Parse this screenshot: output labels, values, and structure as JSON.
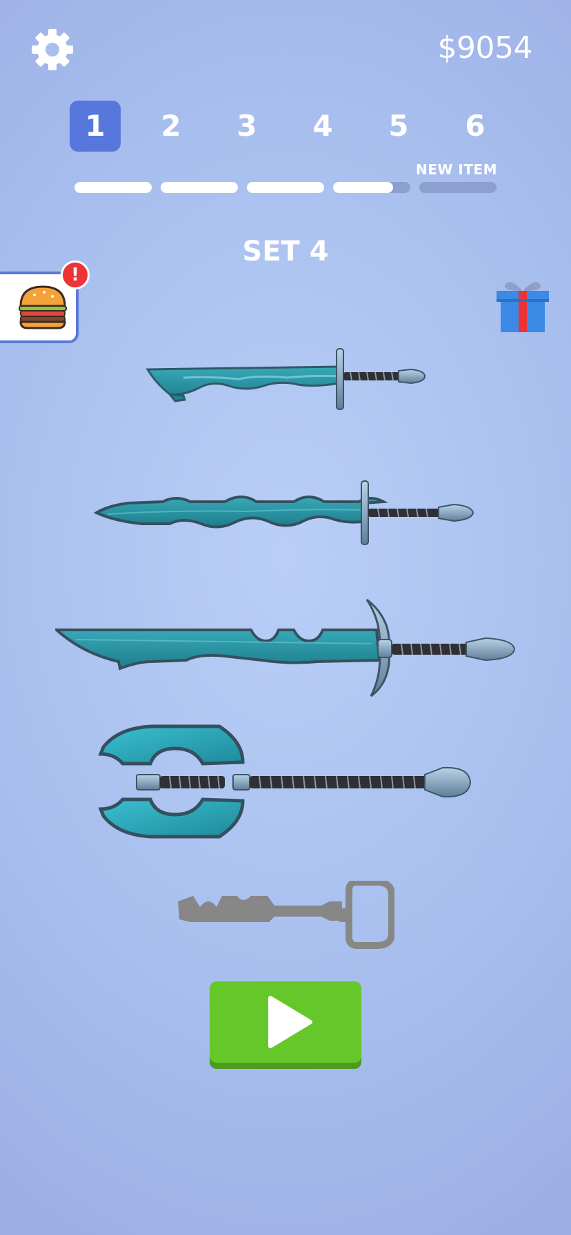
{
  "header": {
    "money": "$9054",
    "settings_icon": "gear-icon"
  },
  "levels": {
    "items": [
      "1",
      "2",
      "3",
      "4",
      "5",
      "6"
    ],
    "active_index": 0,
    "new_item_label": "NEW ITEM",
    "progress": [
      1,
      1,
      1,
      0.78,
      0
    ]
  },
  "set_title": "SET 4",
  "side": {
    "food_icon": "burger-icon",
    "badge": "!",
    "gift_icon": "gift-icon"
  },
  "weapons": [
    "wavy-dagger",
    "serpent-sword",
    "broad-sword",
    "double-axe",
    "locked-key-silhouette"
  ],
  "play": {
    "icon": "play-icon"
  },
  "colors": {
    "accent": "#5877dd",
    "blade": "#2e9aa8",
    "play": "#66c72b",
    "locked": "#878787"
  }
}
